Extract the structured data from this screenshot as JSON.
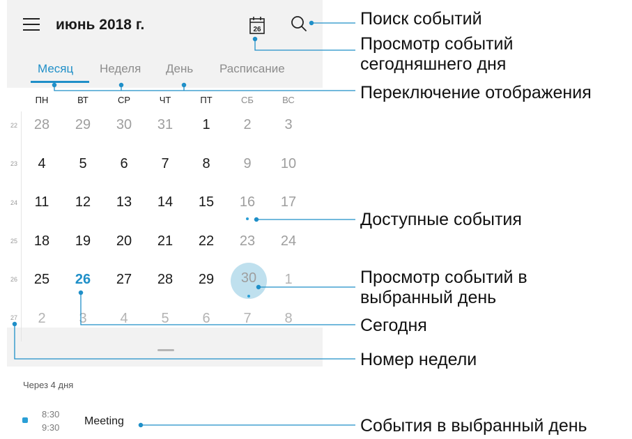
{
  "header": {
    "month_title": "июнь 2018 г.",
    "today_icon_number": "26",
    "icons": [
      "menu-icon",
      "calendar-today-icon",
      "search-icon"
    ]
  },
  "tabs": [
    {
      "label": "Месяц",
      "active": true
    },
    {
      "label": "Неделя",
      "active": false
    },
    {
      "label": "День",
      "active": false
    },
    {
      "label": "Расписание",
      "active": false
    }
  ],
  "weekdays": [
    "ПН",
    "ВТ",
    "СР",
    "ЧТ",
    "ПТ",
    "СБ",
    "ВС"
  ],
  "calendar": {
    "weeks": [
      {
        "number": "22",
        "days": [
          "28",
          "29",
          "30",
          "31",
          "1",
          "2",
          "3"
        ]
      },
      {
        "number": "23",
        "days": [
          "4",
          "5",
          "6",
          "7",
          "8",
          "9",
          "10"
        ]
      },
      {
        "number": "24",
        "days": [
          "11",
          "12",
          "13",
          "14",
          "15",
          "16",
          "17"
        ]
      },
      {
        "number": "25",
        "days": [
          "18",
          "19",
          "20",
          "21",
          "22",
          "23",
          "24"
        ]
      },
      {
        "number": "26",
        "days": [
          "25",
          "26",
          "27",
          "28",
          "29",
          "30",
          "1"
        ]
      },
      {
        "number": "27",
        "days": [
          "2",
          "3",
          "4",
          "5",
          "6",
          "7",
          "8"
        ]
      }
    ],
    "today": "26",
    "selected": "30"
  },
  "agenda": {
    "section_label": "Через 4 дня",
    "events": [
      {
        "start": "8:30",
        "end": "9:30",
        "title": "Meeting"
      }
    ]
  },
  "callouts": {
    "search": "Поиск событий",
    "today_line1": "Просмотр событий",
    "today_line2": "сегодняшнего дня",
    "view_switch": "Переключение отображения",
    "available": "Доступные события",
    "selected_line1": "Просмотр событий в",
    "selected_line2": "выбранный день",
    "today_marker": "Сегодня",
    "week_number": "Номер недели",
    "day_events": "События в выбранный день"
  },
  "colors": {
    "accent": "#1f8fc8",
    "event_dot": "#2a9fd6",
    "selected_circle": "#bfe0ee",
    "header_bg": "#f2f2f2"
  }
}
